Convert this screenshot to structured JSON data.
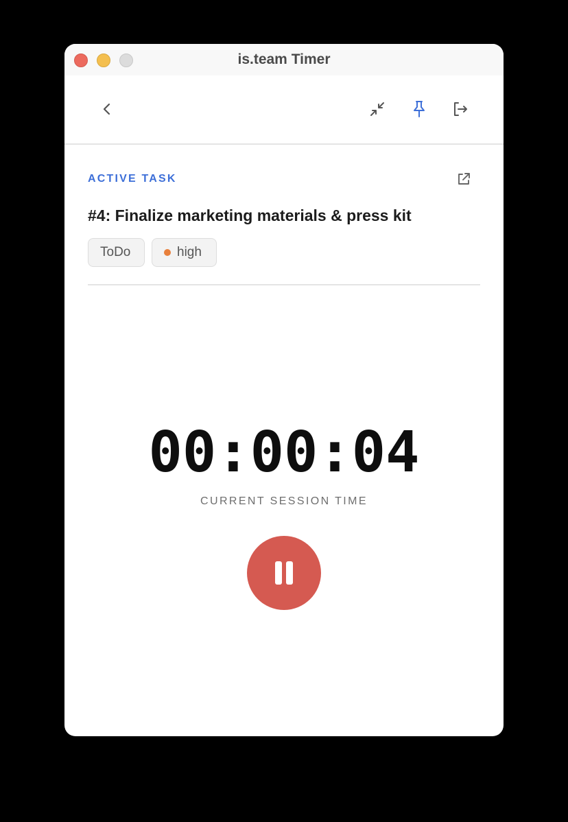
{
  "window": {
    "title": "is.team Timer"
  },
  "toolbar": {
    "icons": [
      "back-chevron-icon",
      "minimize-arrows-icon",
      "pin-icon",
      "logout-icon"
    ],
    "pin_color": "#3d6fd8"
  },
  "task": {
    "section_label": "ACTIVE TASK",
    "title": "#4: Finalize marketing materials & press kit",
    "status": "ToDo",
    "priority": "high",
    "priority_color": "#e8803c",
    "accent_color": "#3d6fd8"
  },
  "timer": {
    "value": "00:00:04",
    "label": "CURRENT SESSION TIME",
    "pause_color": "#d55a51",
    "control_icon": "pause-icon"
  }
}
